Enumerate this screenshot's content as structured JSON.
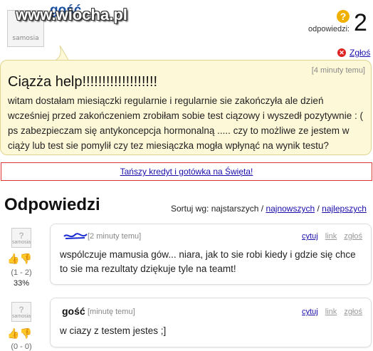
{
  "header": {
    "username": "gość",
    "avatar_text": "samosia",
    "watermark": "www.wiocha.pl",
    "answers_label": "odpowiedzi:",
    "answers_count": "2",
    "report_label": "Zgłoś"
  },
  "question": {
    "time": "[4 minuty temu]",
    "title": "Ciązża help!!!!!!!!!!!!!!!!!!!",
    "body": "witam dostałam miesiączki regularnie i regularnie sie zakończyła ale dzień wcześniej przed zakończeniem zrobiłam sobie test ciązowy i wyszedł pozytywnie : ( ps zabezpieczam się antykoncepcja hormonalną ..... czy to możliwe ze jestem w ciąży lub test sie pomylił czy tez miesiączka mogła wpłynąć na wynik testu?"
  },
  "ad": {
    "link": "Tańszy kredyt i gotówka na Święta!"
  },
  "answers_section": {
    "title": "Odpowiedzi",
    "sort_label": "Sortuj wg:",
    "sort_oldest": "najstarszych",
    "sort_newest": "najnowszych",
    "sort_best": "najlepszych",
    "sep": "/"
  },
  "answers": [
    {
      "author": "",
      "time": "[2 minuty temu]",
      "quote": "cytuj",
      "link": "link",
      "report": "zgłoś",
      "body": "wspólczuje mamusia gów... niara, jak to sie robi kiedy i gdzie się chce to sie ma rezultaty dziękuje tyle na teamt!",
      "votes": "(1 - 2)",
      "percent": "33%"
    },
    {
      "author": "gość",
      "time": "[minutę temu]",
      "quote": "cytuj",
      "link": "link",
      "report": "zgłoś",
      "body": "w ciazy z testem jestes ;]",
      "votes": "(0 - 0)",
      "percent": ""
    }
  ],
  "colors": {
    "accent": "#1a0dab",
    "bubble_bg": "#fdf8d8",
    "ad_border": "#dd3333"
  }
}
